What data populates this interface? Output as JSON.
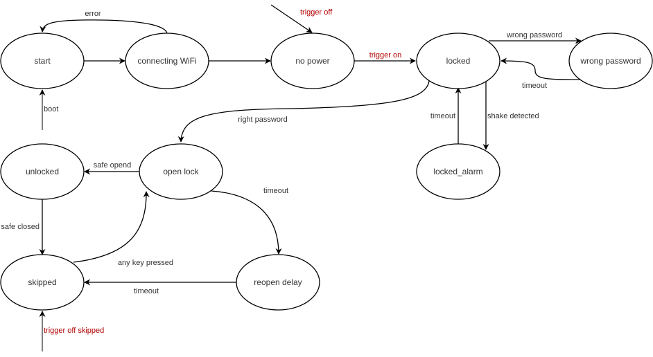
{
  "diagram": {
    "type": "state-machine",
    "states": [
      {
        "id": "start",
        "label": "start"
      },
      {
        "id": "connecting_wifi",
        "label": "connecting WiFi"
      },
      {
        "id": "no_power",
        "label": "no power"
      },
      {
        "id": "locked",
        "label": "locked"
      },
      {
        "id": "wrong_password",
        "label": "wrong password"
      },
      {
        "id": "locked_alarm",
        "label": "locked_alarm"
      },
      {
        "id": "unlocked",
        "label": "unlocked"
      },
      {
        "id": "open_lock",
        "label": "open lock"
      },
      {
        "id": "skipped",
        "label": "skipped"
      },
      {
        "id": "reopen_delay",
        "label": "reopen delay"
      }
    ],
    "transitions": [
      {
        "from": null,
        "to": "start",
        "label": "boot",
        "highlight": false
      },
      {
        "from": "start",
        "to": "connecting_wifi",
        "label": "",
        "highlight": false
      },
      {
        "from": "connecting_wifi",
        "to": "start",
        "label": "error",
        "highlight": false
      },
      {
        "from": "connecting_wifi",
        "to": "no_power",
        "label": "",
        "highlight": false
      },
      {
        "from": null,
        "to": "no_power",
        "label": "trigger off",
        "highlight": true
      },
      {
        "from": "no_power",
        "to": "locked",
        "label": "trigger on",
        "highlight": true
      },
      {
        "from": "locked",
        "to": "wrong_password",
        "label": "wrong password",
        "highlight": false
      },
      {
        "from": "wrong_password",
        "to": "locked",
        "label": "timeout",
        "highlight": false
      },
      {
        "from": "locked",
        "to": "locked_alarm",
        "label": "shake detected",
        "highlight": false
      },
      {
        "from": "locked_alarm",
        "to": "locked",
        "label": "timeout",
        "highlight": false
      },
      {
        "from": "locked",
        "to": "open_lock",
        "label": "right password",
        "highlight": false
      },
      {
        "from": "open_lock",
        "to": "unlocked",
        "label": "safe opend",
        "highlight": false
      },
      {
        "from": "unlocked",
        "to": "skipped",
        "label": "safe closed",
        "highlight": false
      },
      {
        "from": "skipped",
        "to": "open_lock",
        "label": "any key pressed",
        "highlight": false
      },
      {
        "from": "open_lock",
        "to": "reopen_delay",
        "label": "timeout",
        "highlight": false
      },
      {
        "from": "reopen_delay",
        "to": "skipped",
        "label": "timeout",
        "highlight": false
      },
      {
        "from": null,
        "to": "skipped",
        "label": "trigger off skipped",
        "highlight": true
      }
    ],
    "colors": {
      "stroke": "#000000",
      "text": "#333333",
      "highlight_text": "#b20000",
      "initial_edge": "#808080"
    }
  }
}
